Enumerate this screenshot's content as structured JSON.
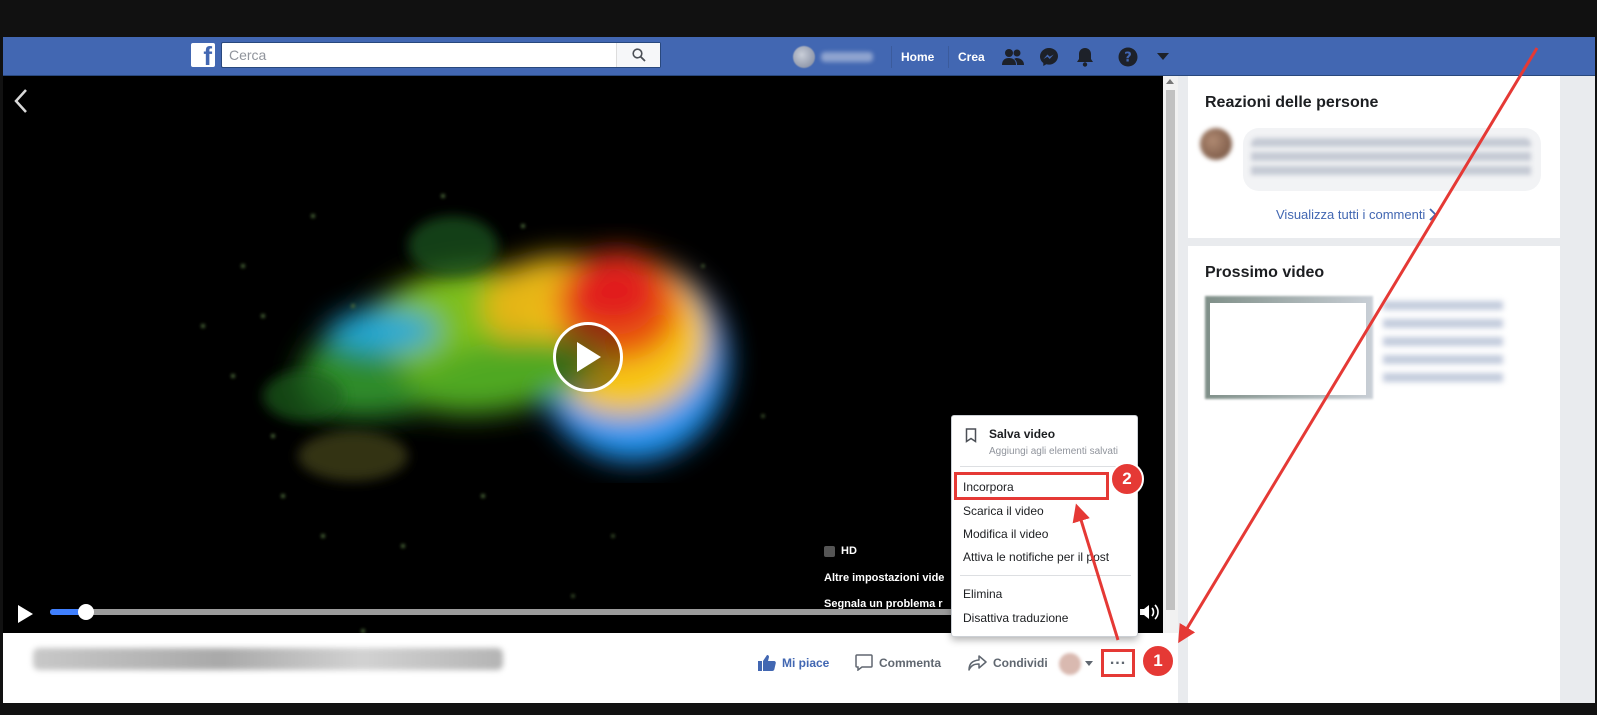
{
  "topbar": {
    "search_placeholder": "Cerca",
    "nav_home": "Home",
    "nav_crea": "Crea",
    "color": "#4267b2"
  },
  "player": {
    "hd_label": "HD",
    "altre_impostazioni": "Altre impostazioni vide",
    "segnala": "Segnala un problema r",
    "progress": 0.033
  },
  "actions": {
    "like": "Mi piace",
    "comment": "Commenta",
    "share": "Condividi"
  },
  "sidebar": {
    "reactions_title": "Reazioni delle persone",
    "view_all_comments": "Visualizza tutti i commenti",
    "next_video_title": "Prossimo video"
  },
  "menu": {
    "save_label": "Salva video",
    "save_sub": "Aggiungi agli elementi salvati",
    "items": [
      "Incorpora",
      "Scarica il video",
      "Modifica il video",
      "Attiva le notifiche per il post",
      "Elimina",
      "Disattiva traduzione"
    ]
  },
  "annotations": {
    "badge_1": "1",
    "badge_2": "2",
    "color": "#e53935"
  }
}
